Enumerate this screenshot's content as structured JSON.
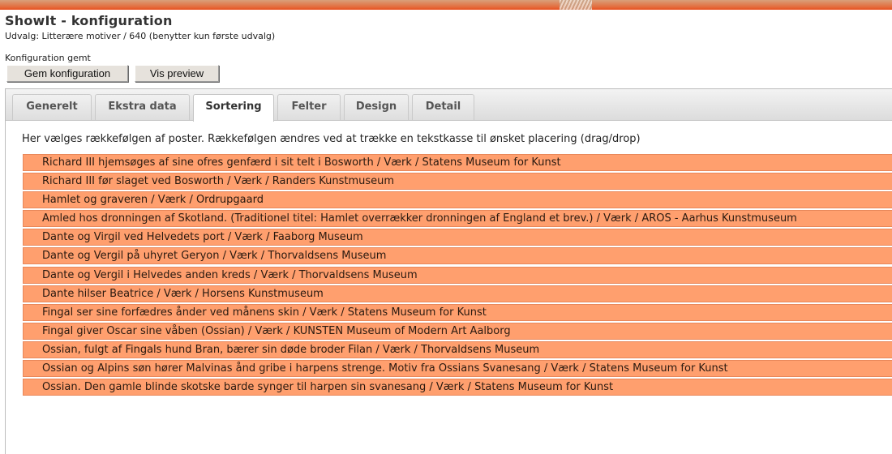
{
  "header": {
    "title": "ShowIt - konfiguration",
    "subtitle": "Udvalg: Litterære motiver / 640 (benytter kun første udvalg)",
    "status": "Konfiguration gemt"
  },
  "toolbar": {
    "save_label": "Gem konfiguration",
    "preview_label": "Vis preview"
  },
  "tabs": [
    {
      "label": "Generelt"
    },
    {
      "label": "Ekstra data"
    },
    {
      "label": "Sortering",
      "active": true
    },
    {
      "label": "Felter"
    },
    {
      "label": "Design"
    },
    {
      "label": "Detail"
    }
  ],
  "sorting": {
    "instruction": "Her vælges rækkefølgen af poster. Rækkefølgen ændres ved at trække en tekstkasse til ønsket placering (drag/drop)",
    "items": [
      "Richard III hjemsøges af sine ofres genfærd i sit telt i Bosworth / Værk / Statens Museum for Kunst",
      "Richard III før slaget ved Bosworth / Værk / Randers Kunstmuseum",
      "Hamlet og graveren / Værk / Ordrupgaard",
      "Amled hos dronningen af Skotland. (Traditionel titel: Hamlet overrækker dronningen af England et brev.) / Værk / AROS - Aarhus Kunstmuseum",
      "Dante og Virgil ved Helvedets port / Værk / Faaborg Museum",
      "Dante og Vergil på uhyret Geryon / Værk / Thorvaldsens Museum",
      "Dante og Vergil i Helvedes anden kreds / Værk / Thorvaldsens Museum",
      "Dante hilser Beatrice / Værk / Horsens Kunstmuseum",
      "Fingal ser sine forfædres ånder ved månens skin / Værk / Statens Museum for Kunst",
      "Fingal giver Oscar sine våben (Ossian) / Værk / KUNSTEN Museum of Modern Art Aalborg",
      "Ossian, fulgt af Fingals hund Bran, bærer sin døde broder Filan / Værk / Thorvaldsens Museum",
      "Ossian og Alpins søn hører Malvinas ånd gribe i harpens strenge. Motiv fra Ossians Svanesang / Værk / Statens Museum for Kunst",
      "Ossian. Den gamle blinde skotske barde synger til harpen sin svanesang / Værk / Statens Museum for Kunst"
    ]
  }
}
